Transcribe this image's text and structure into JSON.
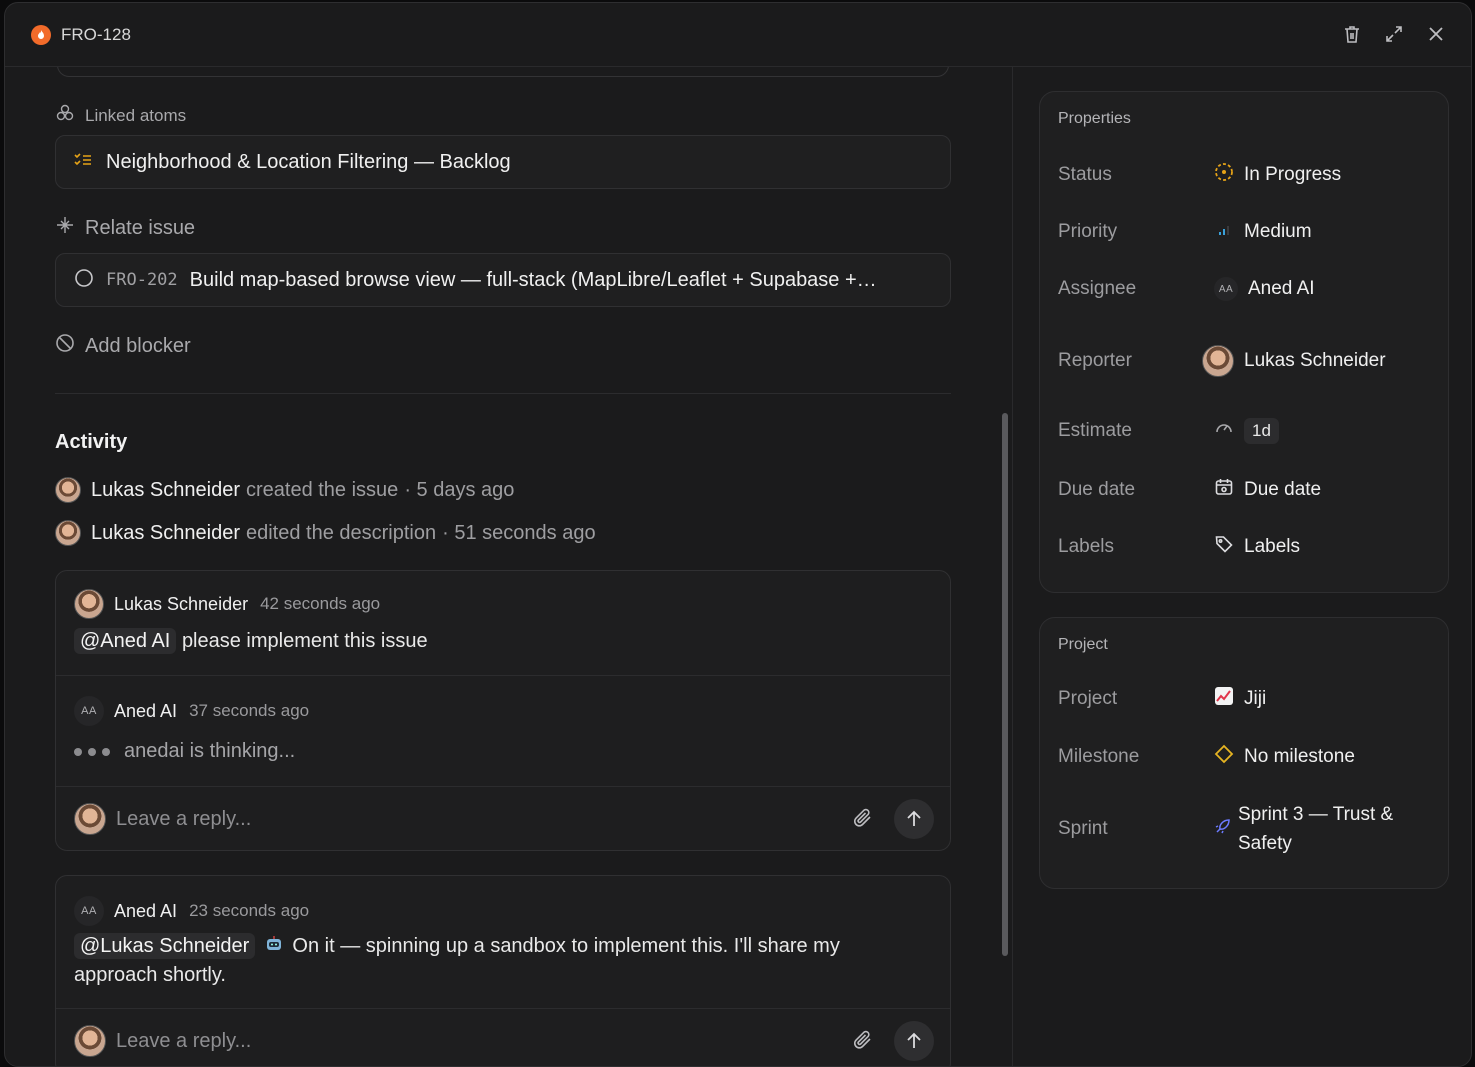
{
  "header": {
    "issue_id": "FRO-128"
  },
  "links": {
    "linked_atoms_label": "Linked atoms",
    "linked_atom": "Neighborhood & Location Filtering — Backlog",
    "relate_label": "Relate issue",
    "related_issue_id": "FRO-202",
    "related_issue_title": "Build map-based browse view — full-stack (MapLibre/Leaflet + Supabase +…",
    "add_blocker_label": "Add blocker"
  },
  "activity": {
    "title": "Activity",
    "events": [
      {
        "name": "Lukas Schneider",
        "action": "created the issue",
        "time": "· 5 days ago"
      },
      {
        "name": "Lukas Schneider",
        "action": "edited the description",
        "time": "· 51 seconds ago"
      }
    ]
  },
  "thread1": {
    "comment1": {
      "author": "Lukas Schneider",
      "time": "42 seconds ago",
      "mention": "@Aned AI",
      "text": "please implement this issue"
    },
    "comment2": {
      "author_initials": "AA",
      "author": "Aned AI",
      "time": "37 seconds ago",
      "thinking": "anedai is thinking..."
    },
    "reply_placeholder": "Leave a reply..."
  },
  "thread2": {
    "comment1": {
      "author_initials": "AA",
      "author": "Aned AI",
      "time": "23 seconds ago",
      "mention": "@Lukas Schneider",
      "text": "On it — spinning up a sandbox to implement this. I'll share my approach shortly."
    },
    "reply_placeholder": "Leave a reply..."
  },
  "properties": {
    "title": "Properties",
    "status_label": "Status",
    "status_value": "In Progress",
    "priority_label": "Priority",
    "priority_value": "Medium",
    "assignee_label": "Assignee",
    "assignee_initials": "AA",
    "assignee_value": "Aned AI",
    "reporter_label": "Reporter",
    "reporter_value": "Lukas Schneider",
    "estimate_label": "Estimate",
    "estimate_value": "1d",
    "due_label": "Due date",
    "due_value": "Due date",
    "labels_label": "Labels",
    "labels_value": "Labels"
  },
  "project": {
    "title": "Project",
    "project_label": "Project",
    "project_value": "Jiji",
    "milestone_label": "Milestone",
    "milestone_value": "No milestone",
    "sprint_label": "Sprint",
    "sprint_value_line1": "Sprint 3 — Trust &",
    "sprint_value_line2": "Safety"
  },
  "colors": {
    "status": "#e6a317",
    "priority": "#3aa0d8",
    "milestone": "#e6b422",
    "sprint": "#6c7bff",
    "issue_badge": "#f26b2a"
  }
}
